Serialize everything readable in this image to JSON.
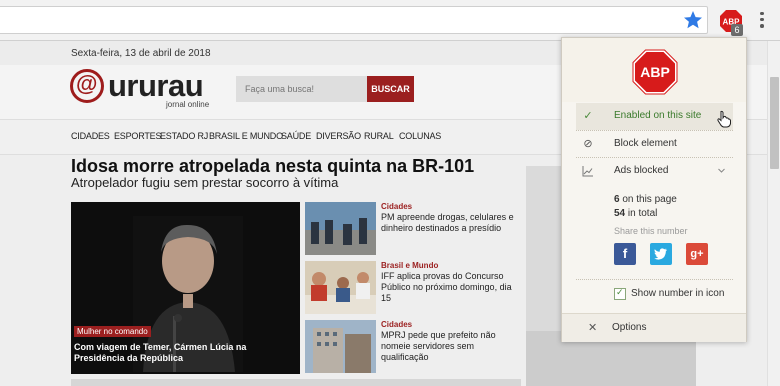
{
  "browser": {
    "extension_badge": "6",
    "abp_icon_text": "ABP"
  },
  "site": {
    "date": "Sexta-feira, 13 de abril de 2018",
    "logo_at": "@",
    "logo_word": "ururau",
    "logo_sub": "jornal online",
    "search_placeholder": "Faça uma busca!",
    "search_button": "BUSCAR",
    "nav": [
      "CIDADES",
      "ESPORTES",
      "ESTADO RJ",
      "BRASIL E MUNDO",
      "SAÚDE",
      "DIVERSÃO",
      "RURAL",
      "COLUNAS"
    ],
    "headline": "Idosa morre atropelada nesta quinta na BR-101",
    "subheadline": "Atropelador fugiu sem prestar socorro à vítima",
    "hero": {
      "tag": "Mulher no comando",
      "caption": "Com viagem de Temer, Cármen Lúcia na Presidência da República"
    },
    "stories": [
      {
        "category": "Cidades",
        "title": "PM apreende drogas, celulares e dinheiro destinados a presídio"
      },
      {
        "category": "Brasil e Mundo",
        "title": "IFF aplica provas do Concurso Público no próximo domingo, dia 15"
      },
      {
        "category": "Cidades",
        "title": "MPRJ pede que prefeito não nomeie servidores sem qualificação"
      }
    ]
  },
  "abp_popup": {
    "logo_text": "ABP",
    "enabled_label": "Enabled on this site",
    "block_element_label": "Block element",
    "ads_blocked_label": "Ads blocked",
    "page_count": "6",
    "page_count_suffix": " on this page",
    "total_count": "54",
    "total_count_suffix": " in total",
    "share_label": "Share this number",
    "social": {
      "facebook": "f",
      "twitter": "t",
      "google": "g+"
    },
    "show_number_label": "Show number in icon",
    "options_label": "Options"
  },
  "colors": {
    "brand_red": "#9b1f1f",
    "abp_red": "#d71b1b",
    "facebook": "#3b5998",
    "twitter": "#2aa9e0",
    "google": "#db4a39",
    "enabled_green": "#3a7a2b"
  }
}
